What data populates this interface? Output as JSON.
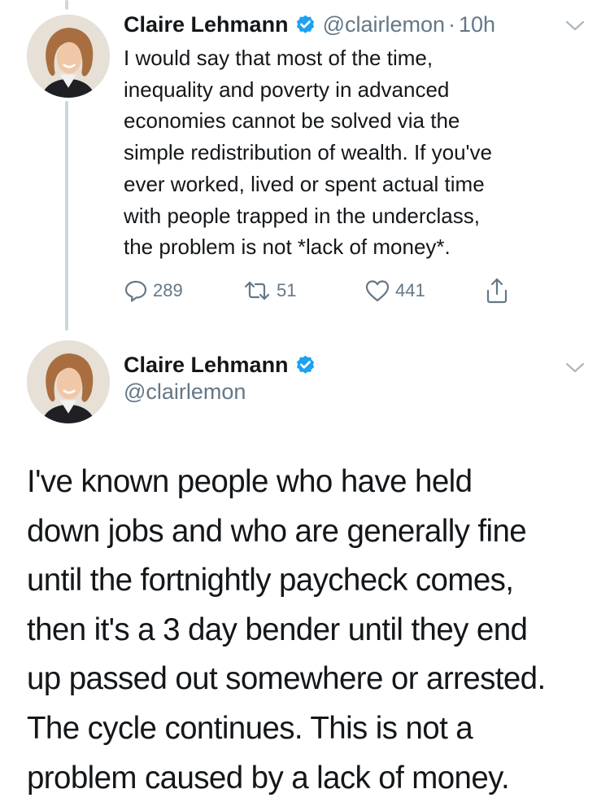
{
  "tweet1": {
    "display_name": "Claire Lehmann",
    "handle": "@clairlemon",
    "separator": "·",
    "time_ago": "10h",
    "text": "I would say that most of the time,\ninequality and poverty in advanced\neconomies cannot be solved via the\nsimple redistribution of wealth. If you've\never worked, lived or spent actual time\nwith people trapped in the underclass,\nthe problem is not *lack of money*.",
    "reply_count": "289",
    "retweet_count": "51",
    "like_count": "441"
  },
  "tweet2": {
    "display_name": "Claire Lehmann",
    "handle": "@clairlemon",
    "text": "I've known people who have held\ndown jobs and who are generally fine\nuntil the fortnightly paycheck comes,\nthen it's a 3 day bender until they end\nup passed out somewhere or arrested.\nThe cycle continues. This is not a\nproblem caused by a lack of money."
  },
  "icons": {
    "verified": "verified-badge-icon",
    "chevron": "chevron-down-icon",
    "reply": "reply-icon",
    "retweet": "retweet-icon",
    "like": "heart-icon",
    "share": "share-icon"
  },
  "colors": {
    "text": "#14171a",
    "secondary": "#657786",
    "verified_blue": "#1da1f2",
    "thread_line": "#ccd6dd"
  }
}
